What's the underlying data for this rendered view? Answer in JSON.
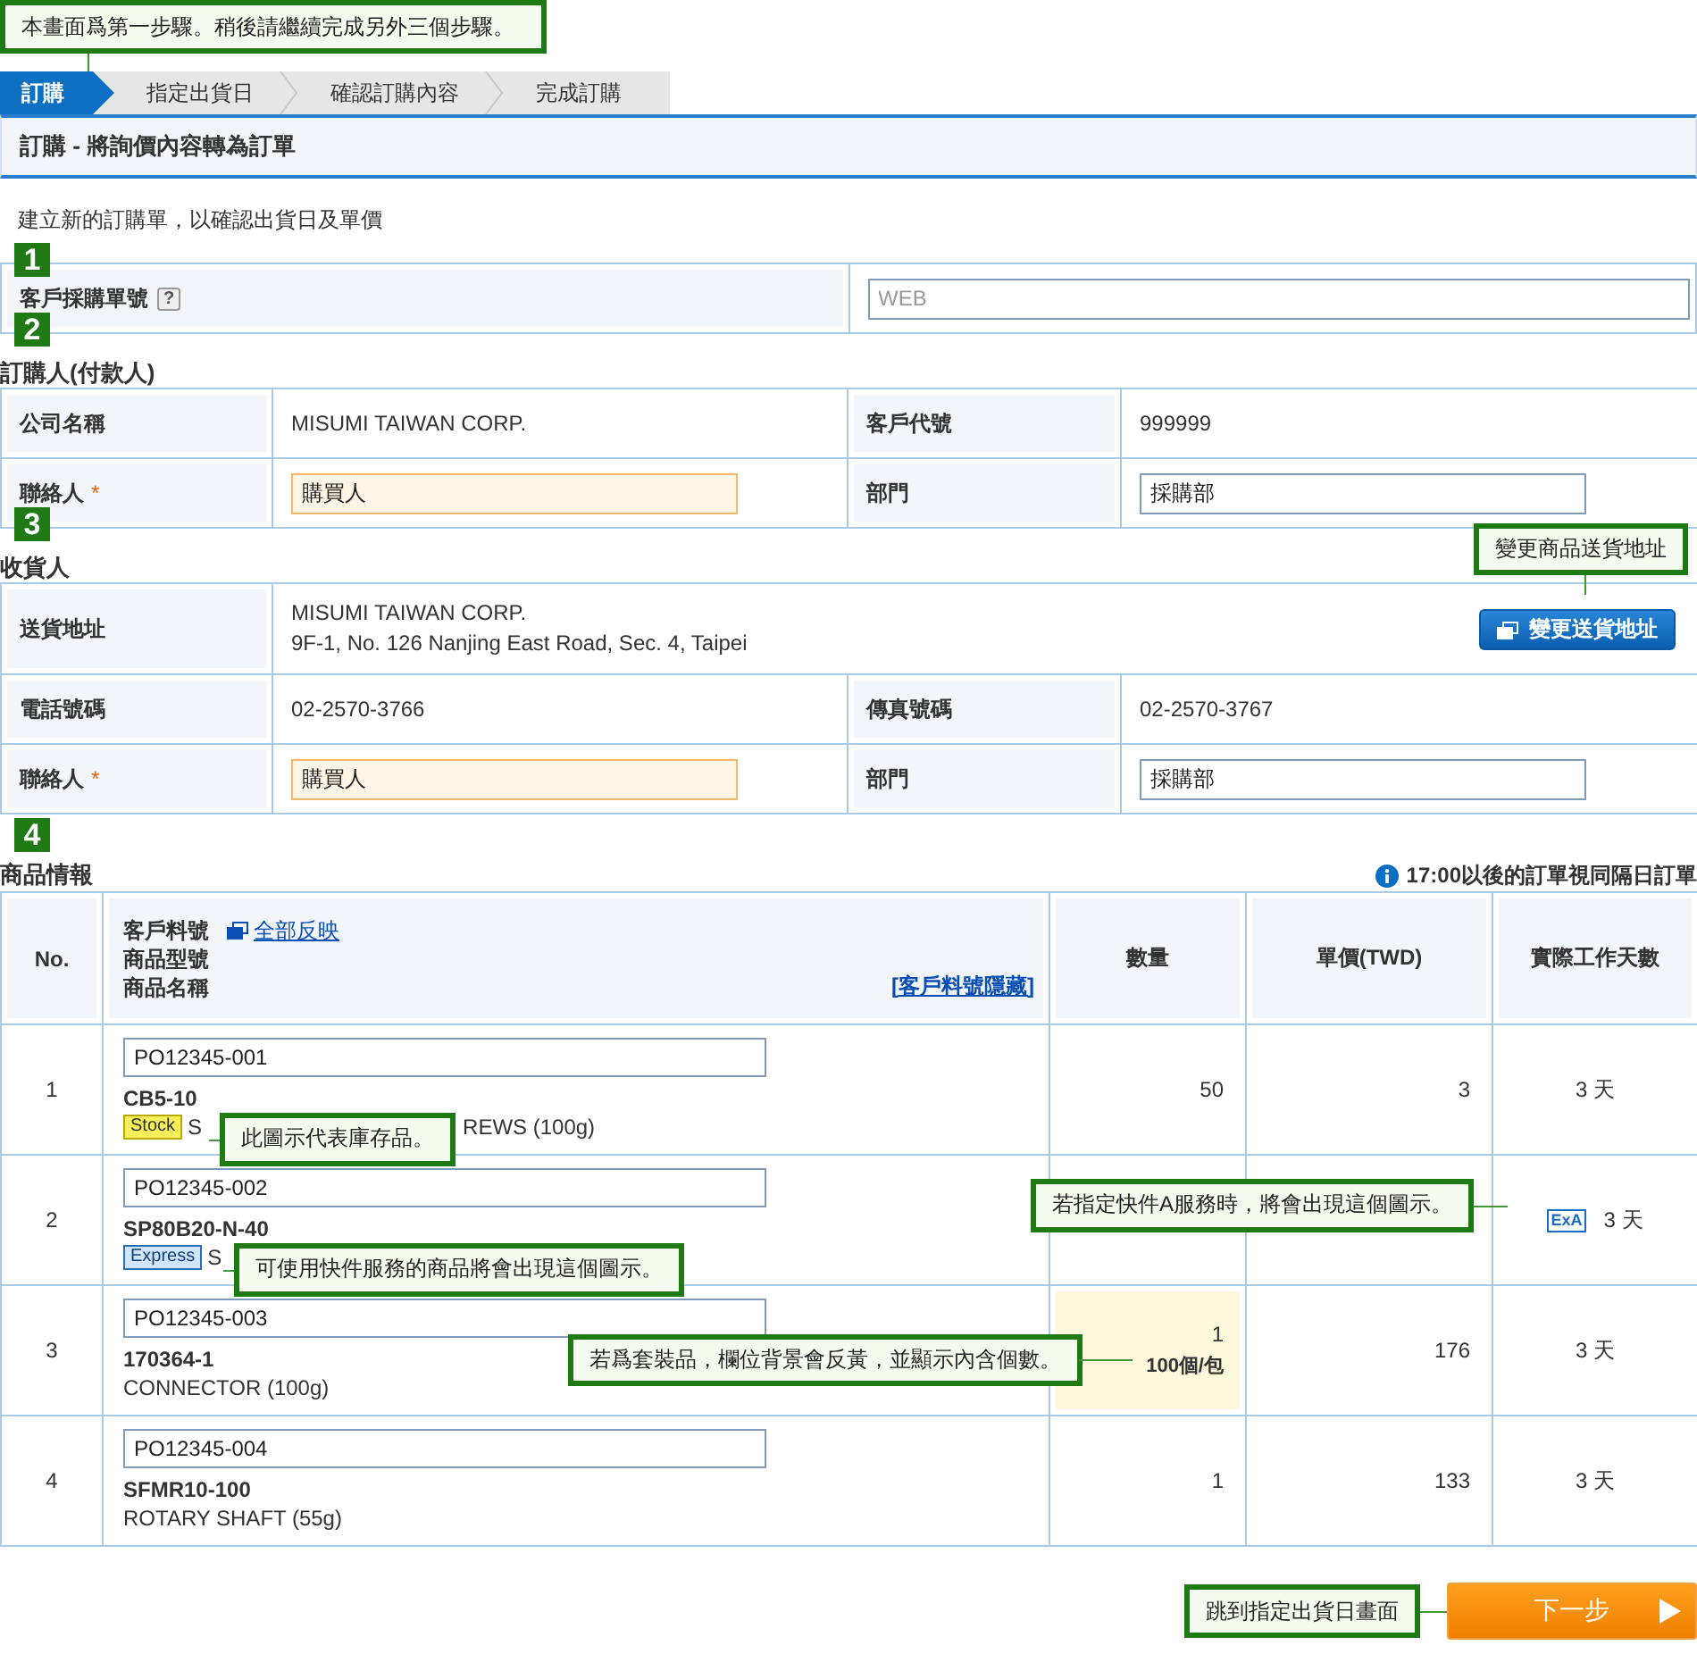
{
  "top_note": "本畫面爲第一步驟。稍後請繼續完成另外三個步驟。",
  "steps": [
    {
      "label": "訂購",
      "selected": true
    },
    {
      "label": "指定出貨日",
      "selected": false
    },
    {
      "label": "確認訂購內容",
      "selected": false
    },
    {
      "label": "完成訂購",
      "selected": false
    }
  ],
  "page_title": "訂購 - 將詢價內容轉為訂單",
  "intro": "建立新的訂購單，以確認出貨日及單價",
  "order_no": {
    "badge": "1",
    "label": "客戶採購單號",
    "help": "?",
    "field": {
      "placeholder": "WEB"
    }
  },
  "buyer": {
    "badge": "2",
    "heading": "訂購人(付款人)",
    "rows": [
      [
        {
          "kind": "label",
          "text": "公司名稱"
        },
        {
          "kind": "text",
          "lines": [
            "MISUMI TAIWAN CORP."
          ]
        },
        {
          "kind": "label",
          "text": "客戶代號"
        },
        {
          "kind": "text",
          "lines": [
            "999999"
          ]
        }
      ],
      [
        {
          "kind": "label",
          "text": "聯絡人",
          "mark": "*"
        },
        {
          "kind": "input",
          "value": "購買人",
          "required": true
        },
        {
          "kind": "label",
          "text": "部門"
        },
        {
          "kind": "input",
          "value": "採購部",
          "required": false
        }
      ]
    ]
  },
  "consignee": {
    "badge": "3",
    "heading": "收貨人",
    "rows": [
      [
        {
          "kind": "label",
          "text": "送貨地址"
        },
        {
          "kind": "address",
          "colspan": 3,
          "lines": [
            "MISUMI TAIWAN CORP.",
            "9F-1, No. 126 Nanjing East Road, Sec. 4, Taipei"
          ],
          "button": "變更送貨地址",
          "callout": "變更商品送貨地址"
        }
      ],
      [
        {
          "kind": "label",
          "text": "電話號碼"
        },
        {
          "kind": "text",
          "lines": [
            "02-2570-3766"
          ]
        },
        {
          "kind": "label",
          "text": "傳真號碼"
        },
        {
          "kind": "text",
          "lines": [
            "02-2570-3767"
          ]
        }
      ],
      [
        {
          "kind": "label",
          "text": "聯絡人",
          "mark": "*"
        },
        {
          "kind": "input",
          "value": "購買人",
          "required": true
        },
        {
          "kind": "label",
          "text": "部門"
        },
        {
          "kind": "input",
          "value": "採購部",
          "required": false
        }
      ]
    ]
  },
  "products": {
    "badge": "4",
    "heading": "商品情報",
    "notice": "17:00以後的訂單視同隔日訂單",
    "columns": {
      "no": "No.",
      "item_lines": [
        "客戶料號",
        "商品型號",
        "商品名稱"
      ],
      "reflect_link": "全部反映",
      "hide_link": "[客戶料號隱藏]",
      "qty": "數量",
      "price": "單價(TWD)",
      "days": "實際工作天數"
    },
    "rows": [
      {
        "no": "1",
        "part_no": "PO12345-001",
        "model": "CB5-10",
        "tag": {
          "kind": "stock",
          "text": "Stock"
        },
        "name_parts": [
          "S",
          "REWS (100g)"
        ],
        "callout": "此圖示代表庫存品。",
        "qty": "50",
        "pack": false,
        "price": "3",
        "days": "3 天"
      },
      {
        "no": "2",
        "part_no": "PO12345-002",
        "model": "SP80B20-N-40",
        "tag": {
          "kind": "express",
          "text": "Express"
        },
        "name_parts": [
          "S"
        ],
        "callout": "可使用快件服務的商品將會出現這個圖示。",
        "pack": false,
        "days": "3 天",
        "days_badge": "ExA",
        "days_callout": "若指定快件A服務時，將會出現這個圖示。"
      },
      {
        "no": "3",
        "part_no": "PO12345-003",
        "model": "170364-1",
        "name_parts": [
          "CONNECTOR (100g)"
        ],
        "callout": "若爲套裝品，欄位背景會反黃，並顯示內含個數。",
        "qty": "1",
        "pack": true,
        "pack_note": "100個/包",
        "price": "176",
        "days": "3 天"
      },
      {
        "no": "4",
        "part_no": "PO12345-004",
        "model": "SFMR10-100",
        "name_parts": [
          "ROTARY SHAFT (55g)"
        ],
        "qty": "1",
        "pack": false,
        "price": "133",
        "days": "3 天"
      }
    ]
  },
  "next": {
    "callout": "跳到指定出貨日畫面",
    "button": "下一步"
  }
}
